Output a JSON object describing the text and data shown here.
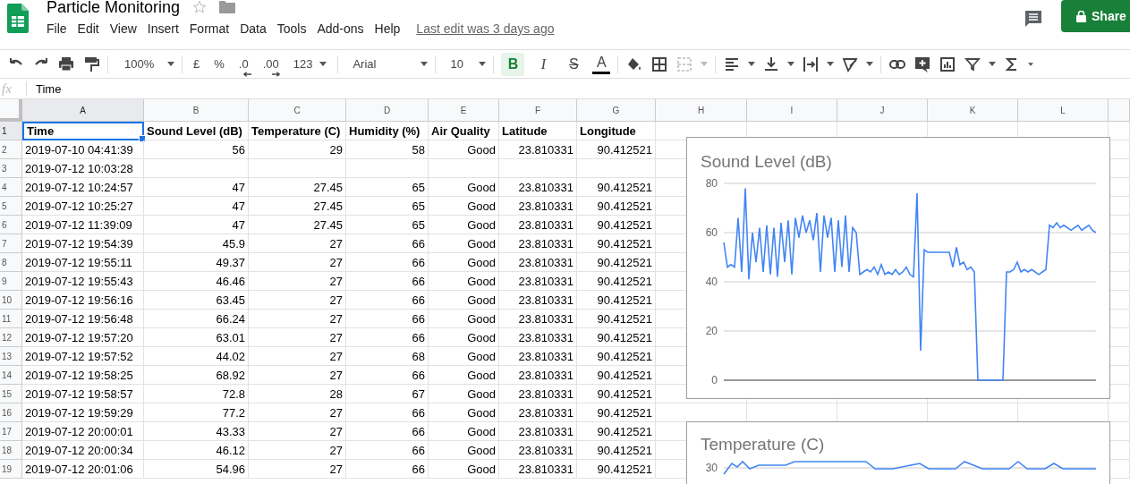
{
  "document": {
    "title": "Particle Monitoring",
    "last_edit": "Last edit was 3 days ago"
  },
  "menu": [
    "File",
    "Edit",
    "View",
    "Insert",
    "Format",
    "Data",
    "Tools",
    "Add-ons",
    "Help"
  ],
  "share_button": "Share",
  "toolbar": {
    "zoom": "100%",
    "currency": "£",
    "percent": "%",
    "decimal_decrease": ".0",
    "decimal_increase": ".00",
    "number_format": "123",
    "font": "Arial",
    "font_size": "10",
    "bold": {
      "label": "B",
      "selected": true
    },
    "italic": {
      "label": "I",
      "selected": false
    },
    "strikethrough": {
      "label": "S",
      "selected": false
    },
    "text_color": {
      "label": "A",
      "color": "#000000"
    }
  },
  "formula_bar": {
    "icon_text": "fx",
    "value": "Time"
  },
  "columns": [
    {
      "label": "A",
      "selected": true
    },
    {
      "label": "B",
      "selected": false
    },
    {
      "label": "C",
      "selected": false
    },
    {
      "label": "D",
      "selected": false
    },
    {
      "label": "E",
      "selected": false
    },
    {
      "label": "F",
      "selected": false
    },
    {
      "label": "G",
      "selected": false
    },
    {
      "label": "H",
      "selected": false
    },
    {
      "label": "I",
      "selected": false
    },
    {
      "label": "J",
      "selected": false
    },
    {
      "label": "K",
      "selected": false
    },
    {
      "label": "L",
      "selected": false
    }
  ],
  "rows": [
    {
      "number": "1",
      "selected": true,
      "cells": [
        "Time",
        "Sound Level (dB)",
        "Temperature (C)",
        "Humidity (%)",
        "Air Quality",
        "Latitude",
        "Longitude"
      ]
    },
    {
      "number": "2",
      "selected": false,
      "cells": [
        "2019-07-10 04:41:39",
        "56",
        "29",
        "58",
        "Good",
        "23.810331",
        "90.412521"
      ]
    },
    {
      "number": "3",
      "selected": false,
      "cells": [
        "2019-07-12 10:03:28"
      ]
    },
    {
      "number": "4",
      "selected": false,
      "cells": [
        "2019-07-12 10:24:57",
        "47",
        "27.45",
        "65",
        "Good",
        "23.810331",
        "90.412521"
      ]
    },
    {
      "number": "5",
      "selected": false,
      "cells": [
        "2019-07-12 10:25:27",
        "47",
        "27.45",
        "65",
        "Good",
        "23.810331",
        "90.412521"
      ]
    },
    {
      "number": "6",
      "selected": false,
      "cells": [
        "2019-07-12 11:39:09",
        "47",
        "27.45",
        "65",
        "Good",
        "23.810331",
        "90.412521"
      ]
    },
    {
      "number": "7",
      "selected": false,
      "cells": [
        "2019-07-12 19:54:39",
        "45.9",
        "27",
        "66",
        "Good",
        "23.810331",
        "90.412521"
      ]
    },
    {
      "number": "8",
      "selected": false,
      "cells": [
        "2019-07-12 19:55:11",
        "49.37",
        "27",
        "66",
        "Good",
        "23.810331",
        "90.412521"
      ]
    },
    {
      "number": "9",
      "selected": false,
      "cells": [
        "2019-07-12 19:55:43",
        "46.46",
        "27",
        "66",
        "Good",
        "23.810331",
        "90.412521"
      ]
    },
    {
      "number": "10",
      "selected": false,
      "cells": [
        "2019-07-12 19:56:16",
        "63.45",
        "27",
        "66",
        "Good",
        "23.810331",
        "90.412521"
      ]
    },
    {
      "number": "11",
      "selected": false,
      "cells": [
        "2019-07-12 19:56:48",
        "66.24",
        "27",
        "66",
        "Good",
        "23.810331",
        "90.412521"
      ]
    },
    {
      "number": "12",
      "selected": false,
      "cells": [
        "2019-07-12 19:57:20",
        "63.01",
        "27",
        "66",
        "Good",
        "23.810331",
        "90.412521"
      ]
    },
    {
      "number": "13",
      "selected": false,
      "cells": [
        "2019-07-12 19:57:52",
        "44.02",
        "27",
        "68",
        "Good",
        "23.810331",
        "90.412521"
      ]
    },
    {
      "number": "14",
      "selected": false,
      "cells": [
        "2019-07-12 19:58:25",
        "68.92",
        "27",
        "66",
        "Good",
        "23.810331",
        "90.412521"
      ]
    },
    {
      "number": "15",
      "selected": false,
      "cells": [
        "2019-07-12 19:58:57",
        "72.8",
        "28",
        "67",
        "Good",
        "23.810331",
        "90.412521"
      ]
    },
    {
      "number": "16",
      "selected": false,
      "cells": [
        "2019-07-12 19:59:29",
        "77.2",
        "27",
        "66",
        "Good",
        "23.810331",
        "90.412521"
      ]
    },
    {
      "number": "17",
      "selected": false,
      "cells": [
        "2019-07-12 20:00:01",
        "43.33",
        "27",
        "66",
        "Good",
        "23.810331",
        "90.412521"
      ]
    },
    {
      "number": "18",
      "selected": false,
      "cells": [
        "2019-07-12 20:00:34",
        "46.12",
        "27",
        "66",
        "Good",
        "23.810331",
        "90.412521"
      ]
    },
    {
      "number": "19",
      "selected": false,
      "cells": [
        "2019-07-12 20:01:06",
        "54.96",
        "27",
        "66",
        "Good",
        "23.810331",
        "90.412521"
      ]
    }
  ],
  "sound_chart": {
    "chart_data": {
      "type": "line",
      "title": "Sound Level (dB)",
      "ylim": [
        0,
        80
      ],
      "yticks": [
        0,
        20,
        40,
        60,
        80
      ],
      "grid": true,
      "series": [
        {
          "color": "#4285f4",
          "values": [
            56,
            46,
            47,
            46,
            66,
            44,
            78,
            41,
            60,
            48,
            62,
            44,
            63,
            43,
            62,
            42,
            64,
            48,
            65,
            43,
            66,
            58,
            67,
            60,
            65,
            57,
            68,
            44,
            67,
            58,
            66,
            44,
            65,
            46,
            67,
            44,
            62,
            60,
            43,
            44,
            45,
            44,
            46,
            43,
            47,
            43,
            44,
            43,
            45,
            43,
            44,
            46,
            43,
            42,
            76,
            12,
            53,
            52,
            52,
            52,
            52,
            52,
            52,
            52,
            46,
            54,
            47,
            48,
            45,
            46,
            44,
            0,
            0,
            0,
            0,
            0,
            0,
            0,
            0,
            44,
            44,
            45,
            48,
            44,
            45,
            44,
            45,
            44,
            43,
            44,
            45,
            63,
            62,
            64,
            62,
            63,
            62,
            61,
            62,
            63,
            61,
            62,
            63,
            61,
            60
          ]
        }
      ]
    }
  },
  "temperature_chart": {
    "title": "Temperature (C)",
    "tick_label": "30"
  }
}
